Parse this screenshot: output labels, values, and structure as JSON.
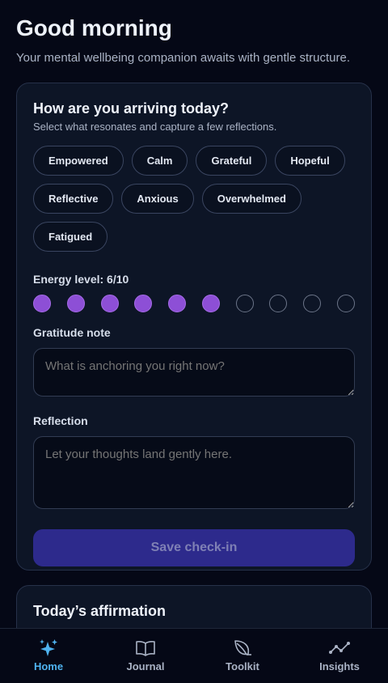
{
  "header": {
    "greeting": "Good morning",
    "subtitle": "Your mental wellbeing companion awaits with gentle structure."
  },
  "checkin": {
    "title": "How are you arriving today?",
    "subtitle": "Select what resonates and capture a few reflections.",
    "moods": [
      "Empowered",
      "Calm",
      "Grateful",
      "Hopeful",
      "Reflective",
      "Anxious",
      "Overwhelmed",
      "Fatigued"
    ],
    "energy_label": "Energy level: 6/10",
    "energy_level": 6,
    "energy_max": 10,
    "gratitude_label": "Gratitude note",
    "gratitude_placeholder": "What is anchoring you right now?",
    "reflection_label": "Reflection",
    "reflection_placeholder": "Let your thoughts land gently here.",
    "save_label": "Save check-in"
  },
  "affirmation": {
    "title": "Today’s affirmation"
  },
  "nav": {
    "items": [
      {
        "label": "Home",
        "icon": "sparkles-icon",
        "active": true
      },
      {
        "label": "Journal",
        "icon": "book-icon",
        "active": false
      },
      {
        "label": "Toolkit",
        "icon": "leaf-icon",
        "active": false
      },
      {
        "label": "Insights",
        "icon": "trend-line-icon",
        "active": false
      }
    ]
  },
  "colors": {
    "accent": "#4fb3f0",
    "energy_fill": "#8d4fd6",
    "save_button": "#2d2a8c"
  }
}
